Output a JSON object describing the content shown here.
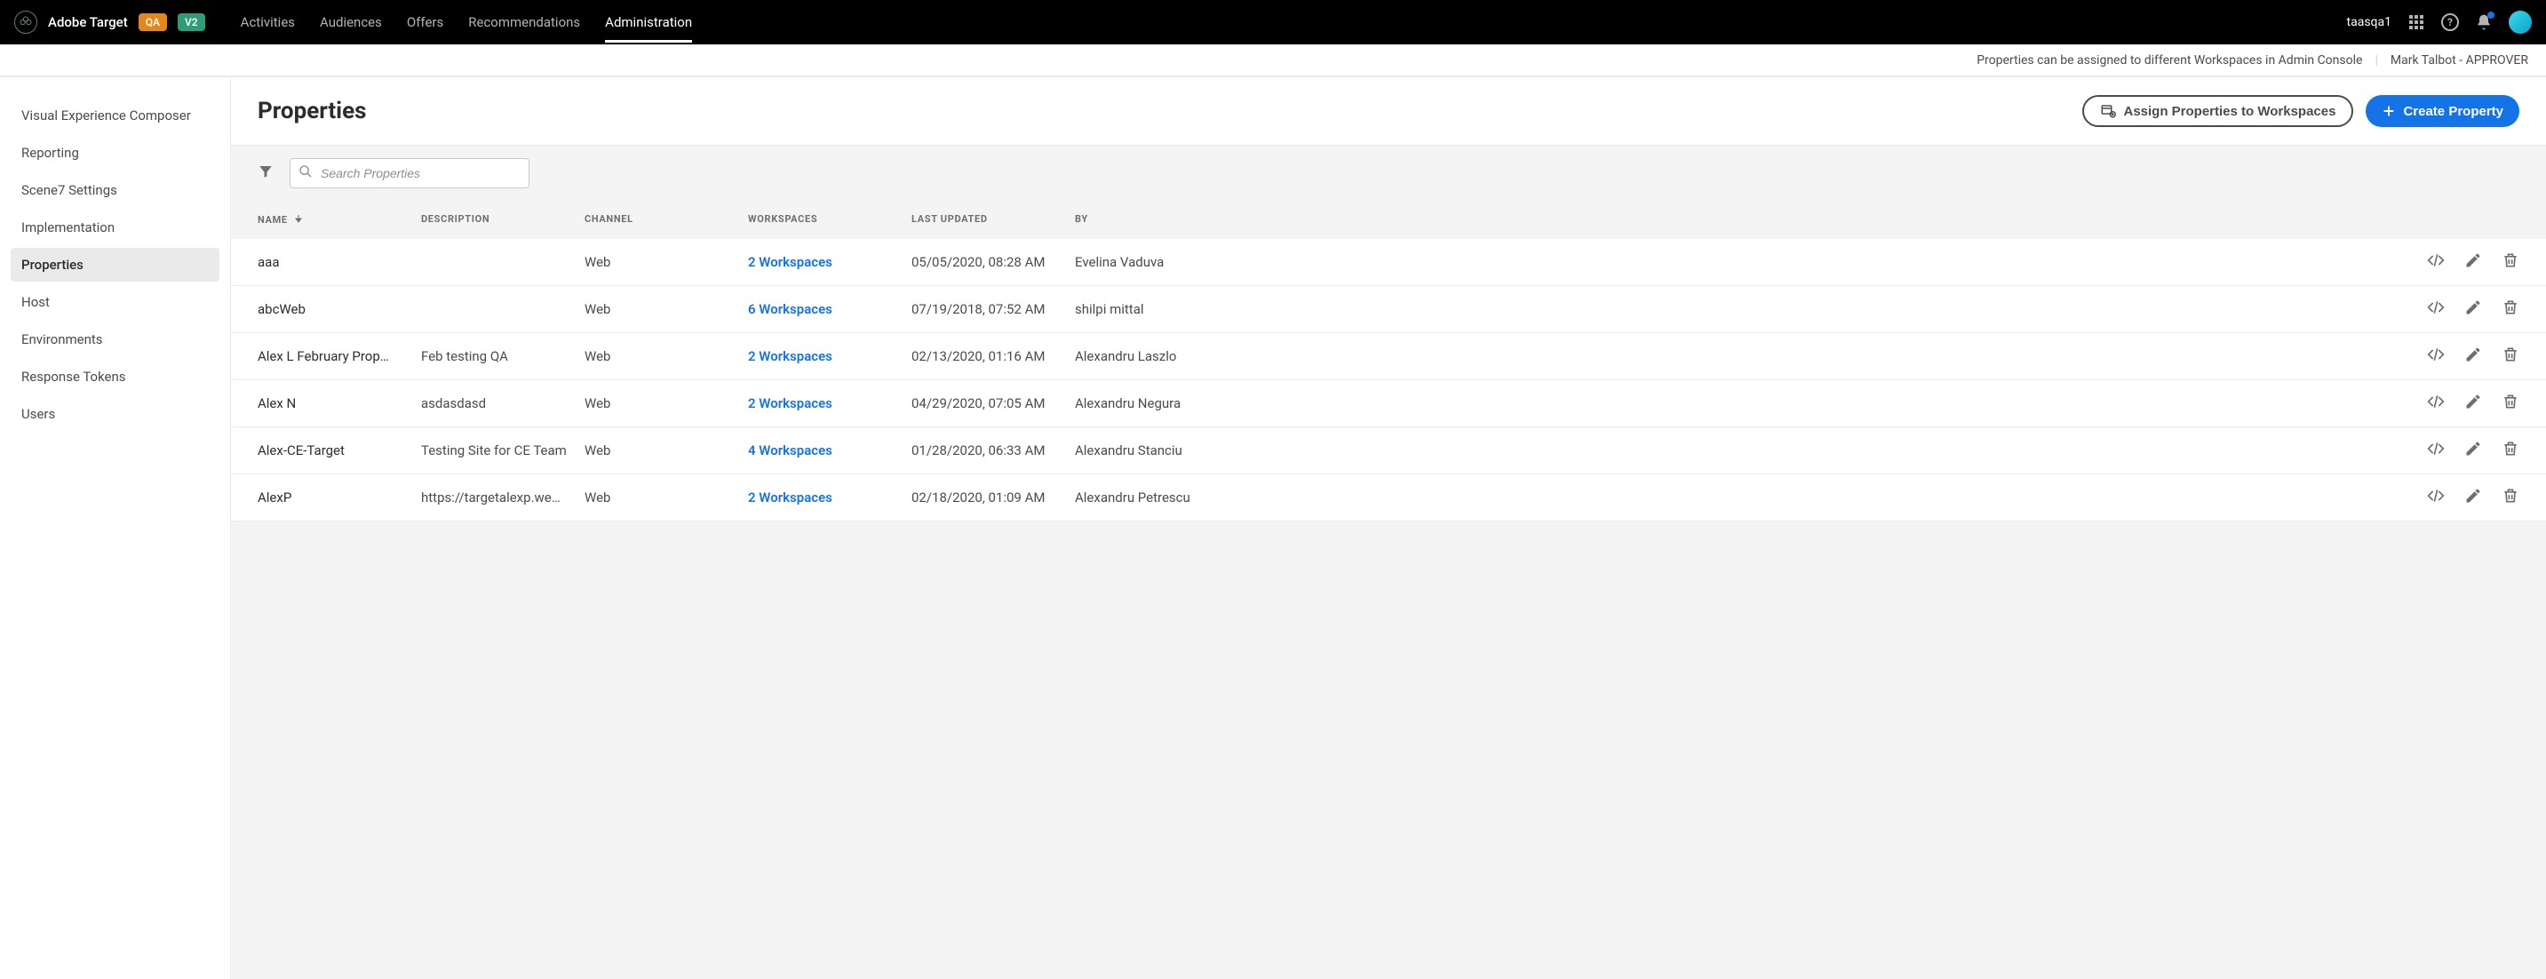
{
  "header": {
    "brand": "Adobe Target",
    "badge_qa": "QA",
    "badge_v2": "V2",
    "nav": [
      "Activities",
      "Audiences",
      "Offers",
      "Recommendations",
      "Administration"
    ],
    "active_nav": "Administration",
    "user": "taasqa1"
  },
  "subheader": {
    "info": "Properties can be assigned to different Workspaces in Admin Console",
    "role": "Mark Talbot - APPROVER"
  },
  "sidebar": {
    "items": [
      "Visual Experience Composer",
      "Reporting",
      "Scene7 Settings",
      "Implementation",
      "Properties",
      "Host",
      "Environments",
      "Response Tokens",
      "Users"
    ],
    "active": "Properties"
  },
  "page": {
    "title": "Properties",
    "assign_btn": "Assign Properties to Workspaces",
    "create_btn": "Create Property",
    "search_placeholder": "Search Properties"
  },
  "columns": {
    "name": "NAME",
    "desc": "DESCRIPTION",
    "chan": "CHANNEL",
    "ws": "WORKSPACES",
    "date": "LAST UPDATED",
    "by": "BY"
  },
  "rows": [
    {
      "name": "aaa",
      "desc": "",
      "chan": "Web",
      "ws": "2 Workspaces",
      "date": "05/05/2020, 08:28 AM",
      "by": "Evelina Vaduva"
    },
    {
      "name": "abcWeb",
      "desc": "",
      "chan": "Web",
      "ws": "6 Workspaces",
      "date": "07/19/2018, 07:52 AM",
      "by": "shilpi mittal"
    },
    {
      "name": "Alex L February Prop…",
      "desc": "Feb testing QA",
      "chan": "Web",
      "ws": "2 Workspaces",
      "date": "02/13/2020, 01:16 AM",
      "by": "Alexandru Laszlo"
    },
    {
      "name": "Alex N",
      "desc": "asdasdasd",
      "chan": "Web",
      "ws": "2 Workspaces",
      "date": "04/29/2020, 07:05 AM",
      "by": "Alexandru Negura"
    },
    {
      "name": "Alex-CE-Target",
      "desc": "Testing Site for CE Team",
      "chan": "Web",
      "ws": "4 Workspaces",
      "date": "01/28/2020, 06:33 AM",
      "by": "Alexandru Stanciu"
    },
    {
      "name": "AlexP",
      "desc": "https://targetalexp.we…",
      "chan": "Web",
      "ws": "2 Workspaces",
      "date": "02/18/2020, 01:09 AM",
      "by": "Alexandru Petrescu"
    }
  ]
}
